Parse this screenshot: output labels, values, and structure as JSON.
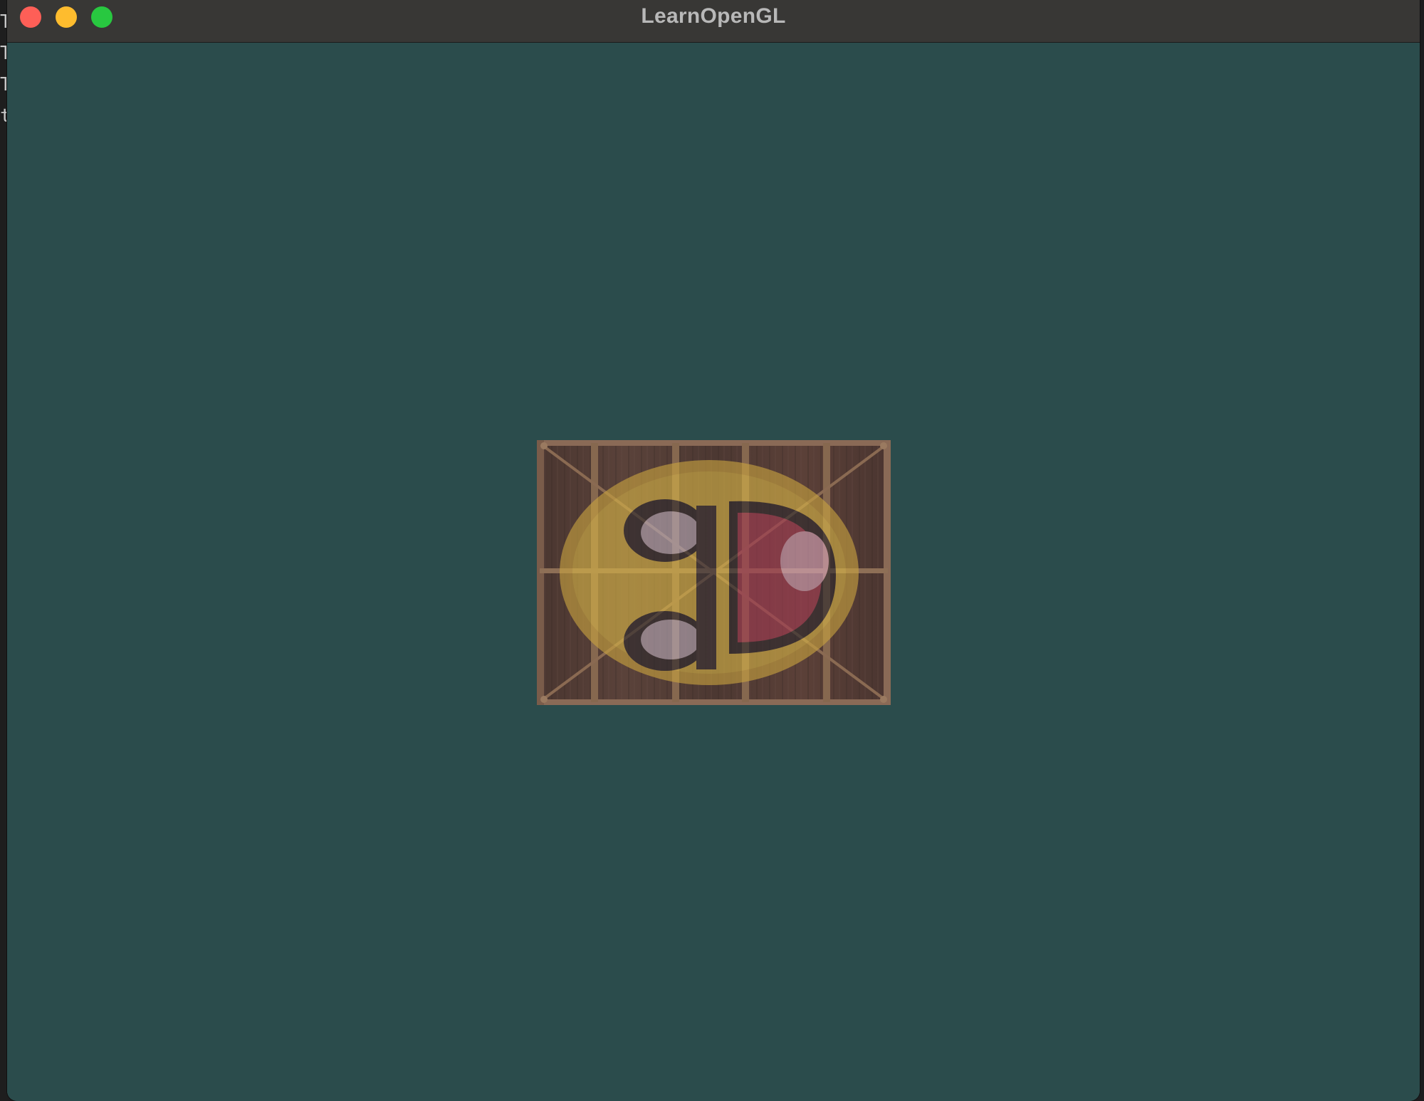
{
  "window": {
    "title": "LearnOpenGL",
    "background_color": "#2b4c4c"
  },
  "traffic_lights": {
    "close_color": "#fe5f57",
    "minimize_color": "#febc2e",
    "maximize_color": "#28c840"
  },
  "scene": {
    "object": "textured-quad",
    "textures": [
      "wooden-container",
      "smiley-face"
    ]
  }
}
